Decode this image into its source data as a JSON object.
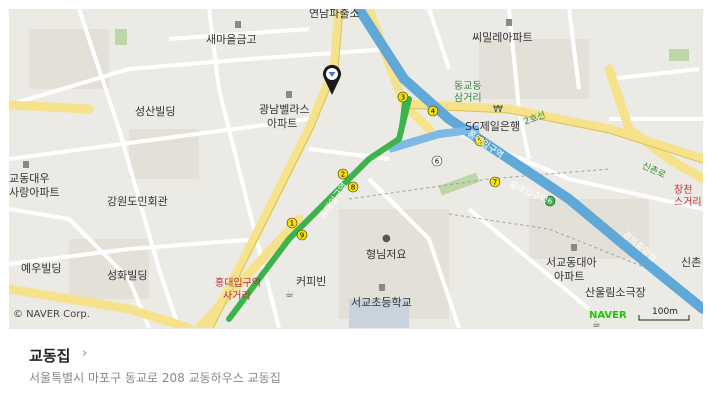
{
  "map": {
    "labels": {
      "police": "연남파출소",
      "saemaeul": "새마을금고",
      "sspmillet": "씨밀레아파트",
      "dongdong": "동교동\n삼거리",
      "dongdong_l1": "동교동",
      "dongdong_l2": "삼거리",
      "sc_bank": "SC제일은행",
      "seongsan": "성산빌딩",
      "gwangnam_l1": "광남벨라스",
      "gwangnam_l2": "아파트",
      "gyodong_l1": "교동대우",
      "gyodong_l2": "사랑아파트",
      "gangwon": "강원도민회관",
      "yeui": "예우빌딩",
      "seonghwa": "성화빌딩",
      "hongdae_l1": "홍대입구역",
      "hongdae_l2": "사거리",
      "coffee": "커피빈",
      "hyeongnim": "형님저요",
      "seogyo_school": "서교초등학교",
      "seogyo_l1": "서교동대아",
      "seogyo_l2": "아파트",
      "sinol": "산울림소극장",
      "sinchon_road": "신촌로",
      "changcheon_l1": "창천",
      "changcheon_l2": "스거리",
      "sinch": "신촌",
      "yanghwa_road": "양화로",
      "road_2": "2호선",
      "hongdae_road": "홍대입구역",
      "jungang": "경의중앙선"
    },
    "attribution": "© NAVER Corp.",
    "brand": "NAVER",
    "scale_label": "100m",
    "colors": {
      "land": "#eceae4",
      "road_main": "#f5e28a",
      "subway_green": "#3cb44b",
      "subway_blue": "#5fa8d8",
      "pin": "#1a1a1a"
    }
  },
  "place": {
    "name": "교동집",
    "address": "서울특별시 마포구 동교로 208 교동하우스 교동집"
  }
}
